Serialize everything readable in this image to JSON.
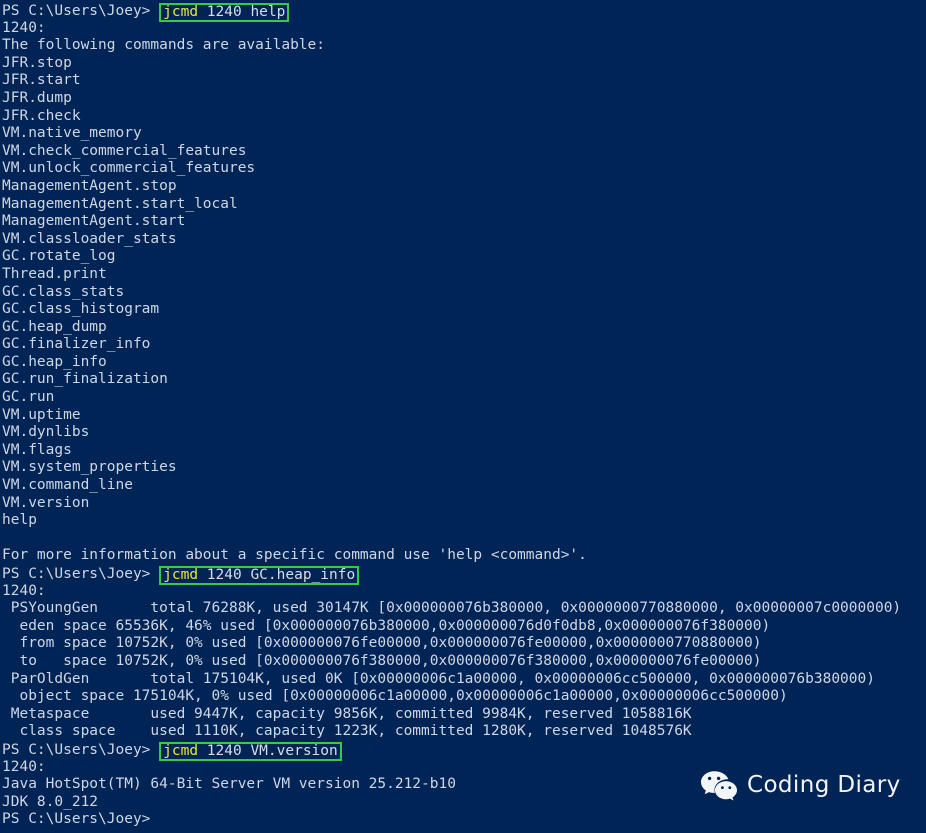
{
  "terminal": {
    "background_color": "#012456",
    "text_color": "#cfd6e4",
    "highlight_border_color": "#36c94a",
    "command_keyword_color": "#e5e54b",
    "prompt": "PS C:\\Users\\Joey>",
    "process_id": "1240"
  },
  "commands": {
    "help": {
      "keyword": "jcmd",
      "args": " 1240 help"
    },
    "heap_info": {
      "keyword": "jcmd",
      "args": " 1240 GC.heap_info"
    },
    "vm_version": {
      "keyword": "jcmd",
      "args": " 1240 VM.version"
    }
  },
  "help_output": {
    "pid_line": "1240:",
    "header": "The following commands are available:",
    "commands": [
      "JFR.stop",
      "JFR.start",
      "JFR.dump",
      "JFR.check",
      "VM.native_memory",
      "VM.check_commercial_features",
      "VM.unlock_commercial_features",
      "ManagementAgent.stop",
      "ManagementAgent.start_local",
      "ManagementAgent.start",
      "VM.classloader_stats",
      "GC.rotate_log",
      "Thread.print",
      "GC.class_stats",
      "GC.class_histogram",
      "GC.heap_dump",
      "GC.finalizer_info",
      "GC.heap_info",
      "GC.run_finalization",
      "GC.run",
      "VM.uptime",
      "VM.dynlibs",
      "VM.flags",
      "VM.system_properties",
      "VM.command_line",
      "VM.version",
      "help"
    ],
    "footer": "For more information about a specific command use 'help <command>'."
  },
  "heap_info_output": {
    "pid_line": "1240:",
    "lines": [
      " PSYoungGen      total 76288K, used 30147K [0x000000076b380000, 0x0000000770880000, 0x00000007c0000000)",
      "  eden space 65536K, 46% used [0x000000076b380000,0x000000076d0f0db8,0x000000076f380000)",
      "  from space 10752K, 0% used [0x000000076fe00000,0x000000076fe00000,0x0000000770880000)",
      "  to   space 10752K, 0% used [0x000000076f380000,0x000000076f380000,0x000000076fe00000)",
      " ParOldGen       total 175104K, used 0K [0x00000006c1a00000, 0x00000006cc500000, 0x000000076b380000)",
      "  object space 175104K, 0% used [0x00000006c1a00000,0x00000006c1a00000,0x00000006cc500000)",
      " Metaspace       used 9447K, capacity 9856K, committed 9984K, reserved 1058816K",
      "  class space    used 1110K, capacity 1223K, committed 1280K, reserved 1048576K"
    ]
  },
  "vm_version_output": {
    "pid_line": "1240:",
    "vm_line": "Java HotSpot(TM) 64-Bit Server VM version 25.212-b10",
    "jdk_line": "JDK 8.0_212"
  },
  "watermark": {
    "label": "Coding Diary",
    "icon": "wechat-icon"
  }
}
